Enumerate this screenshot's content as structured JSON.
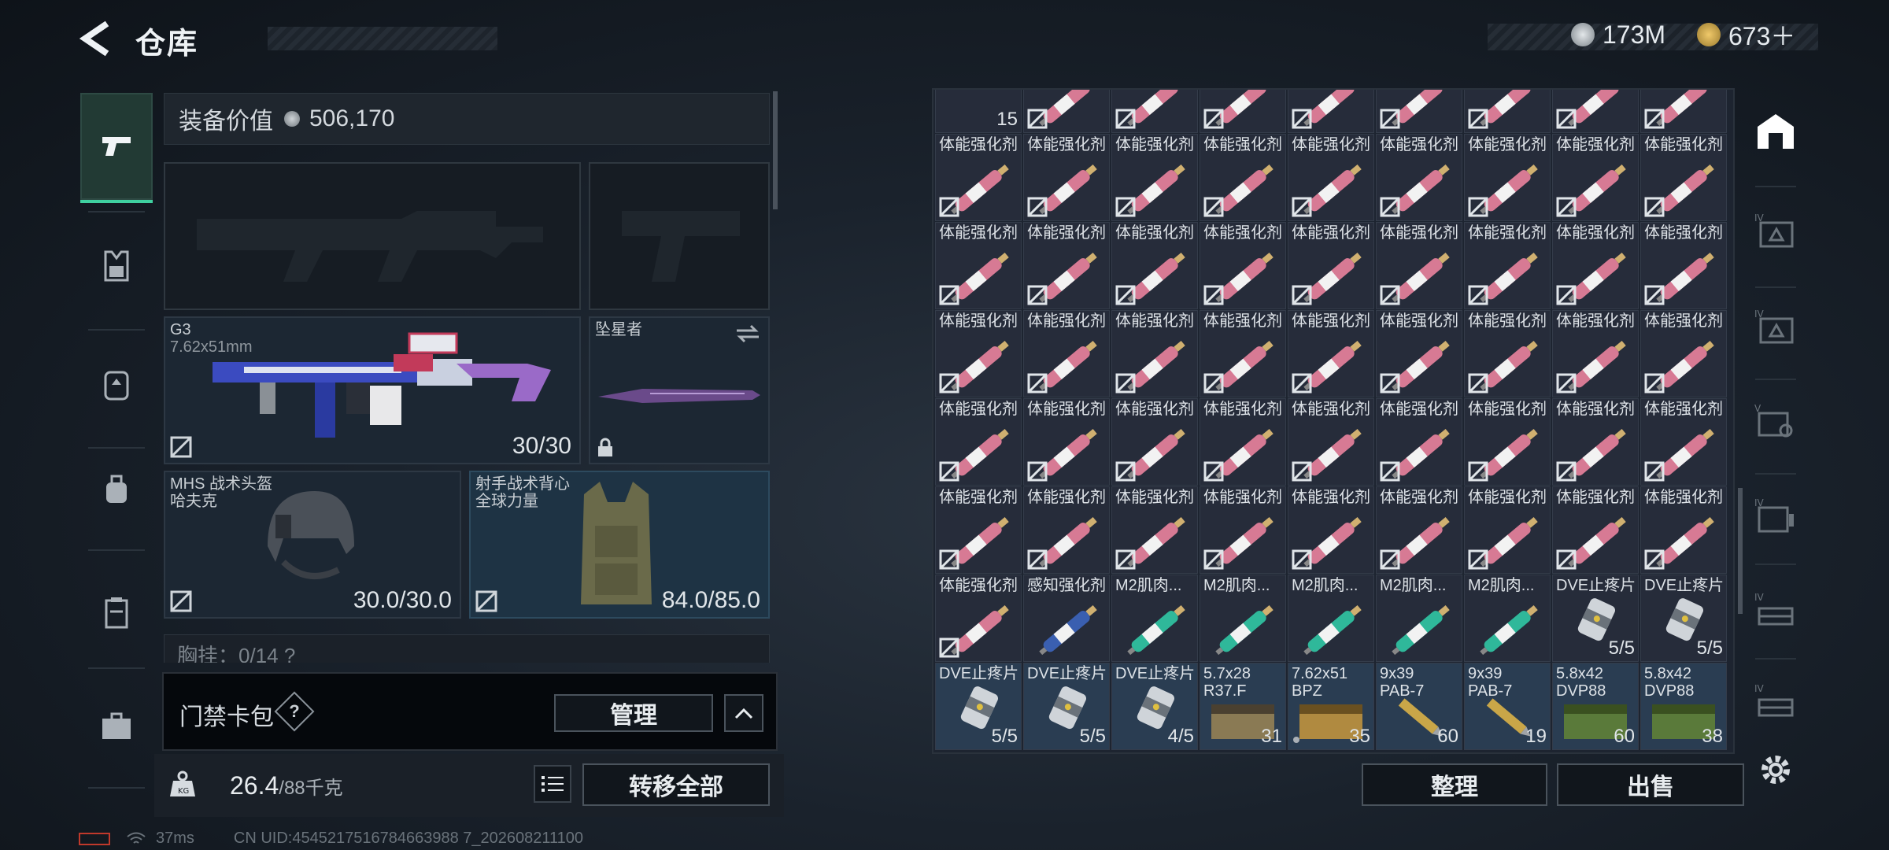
{
  "header": {
    "title": "仓库"
  },
  "currency": {
    "coin_value": "173M",
    "token_value": "673＋"
  },
  "loadout": {
    "value_label": "装备价值",
    "value": "506,170",
    "primary_weapon": {
      "name": "G3",
      "caliber": "7.62x51mm",
      "ammo": "30/30"
    },
    "melee": {
      "name": "坠星者"
    },
    "helmet": {
      "name": "MHS 战术头盔",
      "brand": "哈夫克",
      "durability": "30.0/30.0"
    },
    "armor": {
      "name": "射手战术背心",
      "brand": "全球力量",
      "durability": "84.0/85.0"
    },
    "chest_rig": {
      "label": "胸挂：0/14 ?"
    }
  },
  "keycard": {
    "label": "门禁卡包",
    "help": "?",
    "manage_label": "管理"
  },
  "bottom": {
    "weight": "26.4",
    "weight_max": "/88千克",
    "transfer_all_label": "转移全部"
  },
  "status": {
    "ping": "37ms",
    "uid": "CN UID:4545217516784663988 7_202608211100"
  },
  "inventory": {
    "top_row_first_qty": "15",
    "stim_name": "体能强化剂",
    "row7": [
      {
        "name": "体能强化剂",
        "qty": ""
      },
      {
        "name": "感知强化剂",
        "qty": ""
      },
      {
        "name": "M2肌肉...",
        "qty": ""
      },
      {
        "name": "M2肌肉...",
        "qty": ""
      },
      {
        "name": "M2肌肉...",
        "qty": ""
      },
      {
        "name": "M2肌肉...",
        "qty": ""
      },
      {
        "name": "M2肌肉...",
        "qty": ""
      },
      {
        "name": "DVE止疼片",
        "qty": "5/5"
      },
      {
        "name": "DVE止疼片",
        "qty": "5/5"
      }
    ],
    "row8": [
      {
        "name": "DVE止疼片",
        "name2": "",
        "qty": "5/5"
      },
      {
        "name": "DVE止疼片",
        "name2": "",
        "qty": "5/5"
      },
      {
        "name": "DVE止疼片",
        "name2": "",
        "qty": "4/5"
      },
      {
        "name": "5.7x28",
        "name2": "R37.F",
        "qty": "31"
      },
      {
        "name": "7.62x51",
        "name2": "BPZ",
        "qty": "35"
      },
      {
        "name": "9x39",
        "name2": "PAB-7",
        "qty": "60"
      },
      {
        "name": "9x39",
        "name2": "PAB-7",
        "qty": "19"
      },
      {
        "name": "5.8x42",
        "name2": "DVP88",
        "qty": "60"
      },
      {
        "name": "5.8x42",
        "name2": "DVP88",
        "qty": "38"
      }
    ],
    "sort_label": "整理",
    "sell_label": "出售"
  },
  "colors": {
    "accent": "#3fd0a0",
    "stim_pink": "#d77a94",
    "perception_blue": "#3a5fb0",
    "muscle_teal": "#2fb89a"
  }
}
